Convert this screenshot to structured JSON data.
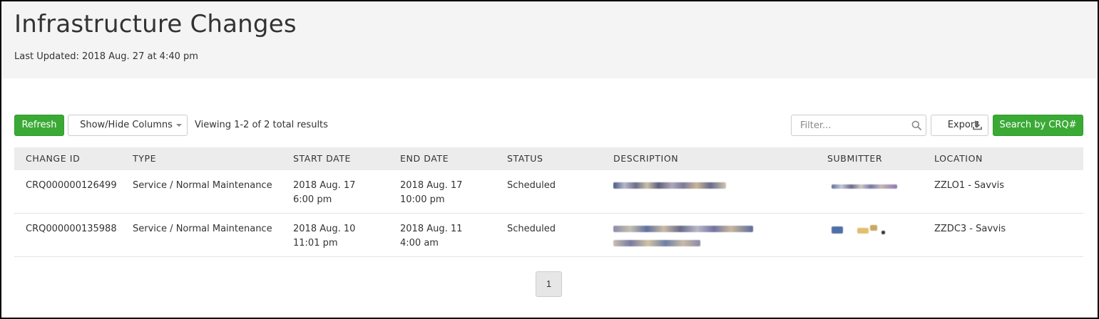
{
  "header": {
    "title": "Infrastructure Changes",
    "last_updated_label": "Last Updated:",
    "last_updated_value": "2018 Aug. 27 at 4:40 pm"
  },
  "toolbar": {
    "refresh_label": "Refresh",
    "columns_label": "Show/Hide Columns",
    "viewing_text": "Viewing 1-2 of 2 total results",
    "filter_placeholder": "Filter...",
    "export_label": "Export",
    "search_crq_label": "Search by CRQ#"
  },
  "icons": {
    "filter": "search-icon",
    "export": "download-icon",
    "columns_dropdown": "caret-down-icon"
  },
  "table": {
    "headers": [
      "CHANGE ID",
      "TYPE",
      "START DATE",
      "END DATE",
      "STATUS",
      "DESCRIPTION",
      "SUBMITTER",
      "LOCATION"
    ],
    "rows": [
      {
        "change_id": "CRQ000000126499",
        "type": "Service / Normal Maintenance",
        "start_date": "2018 Aug. 17",
        "start_time": "6:00 pm",
        "end_date": "2018 Aug. 17",
        "end_time": "10:00 pm",
        "status": "Scheduled",
        "description": "[redacted]",
        "submitter": "[redacted]",
        "location": "ZZLO1 - Savvis"
      },
      {
        "change_id": "CRQ000000135988",
        "type": "Service / Normal Maintenance",
        "start_date": "2018 Aug. 10",
        "start_time": "11:01 pm",
        "end_date": "2018 Aug. 11",
        "end_time": "4:00 am",
        "status": "Scheduled",
        "description": "[redacted]",
        "submitter": "[redacted]",
        "location": "ZZDC3 - Savvis"
      }
    ]
  },
  "pagination": {
    "current_page": "1"
  },
  "colors": {
    "header_bg": "#f4f4f4",
    "primary_green": "#3aaa35",
    "table_header_bg": "#ececec",
    "text": "#333333"
  }
}
